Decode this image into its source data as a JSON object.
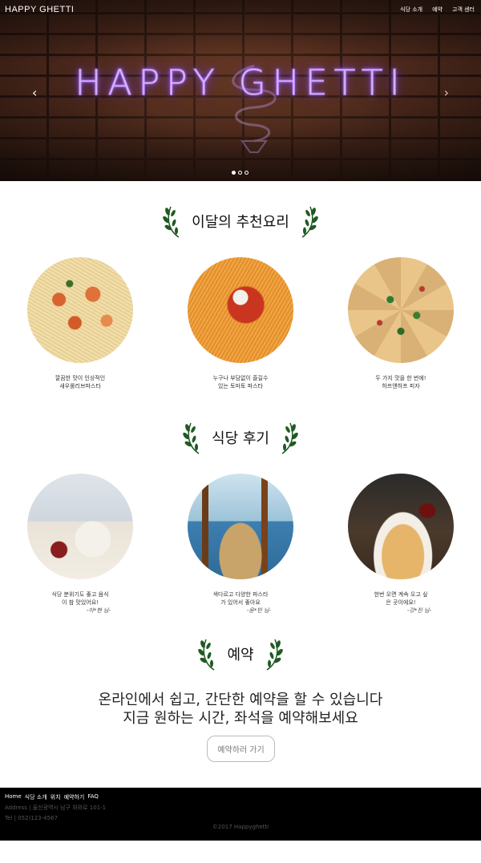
{
  "header": {
    "brand": "HAPPY GHETTI",
    "nav": [
      "식당 소개",
      "예약",
      "고객 센터"
    ]
  },
  "hero": {
    "neon_title": "HAPPY GHETTI",
    "prev_icon": "‹",
    "next_icon": "›",
    "slide_count": 3,
    "active_slide": 1
  },
  "recommend": {
    "title": "이달의 추천요리",
    "items": [
      {
        "caption": "깔끔한 맛이 인상적인\n새우롤리브파스타",
        "image": "shrimp-pasta"
      },
      {
        "caption": "누구나 부담없이 즐길수\n있는 토마토 파스타",
        "image": "tomato-pasta"
      },
      {
        "caption": "두 가지 맛을 한 번에!\n하프앤하프 피자",
        "image": "half-pizza"
      }
    ]
  },
  "reviews": {
    "title": "식당 후기",
    "items": [
      {
        "caption": "식당 분위기도 좋고 음식\n이 참 맛있어요!",
        "author": "-이*현 님-",
        "image": "restaurant-table"
      },
      {
        "caption": "색다르고 다양한 파스타\n가 있어서 좋아요",
        "author": "-윤*민 님-",
        "image": "beer-table"
      },
      {
        "caption": "한번 오면 계속 오고 싶\n은 곳이에요!",
        "author": "-강*진 님-",
        "image": "wine-pasta"
      }
    ]
  },
  "reservation": {
    "title": "예약",
    "text": "온라인에서 쉽고, 간단한 예약을 할 수 있습니다\n지금 원하는 시간, 좌석을 예약해보세요",
    "button_label": "예약하러 가기"
  },
  "footer": {
    "nav": [
      "Home",
      "식당 소개",
      "위치",
      "예약하기",
      "FAQ"
    ],
    "address": "Address | 울산광역시 남구 와와로 101-1",
    "tel": "Tel | 052)123-4567",
    "copyright": "©2017 Happyghetti"
  },
  "colors": {
    "footer_bg": "#000000",
    "neon": "#b27cff",
    "laurel": "#1f5a22"
  }
}
